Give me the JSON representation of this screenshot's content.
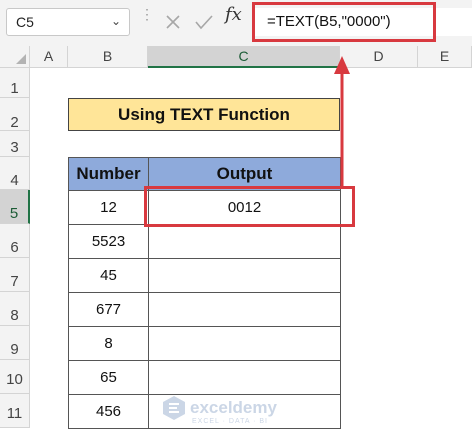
{
  "name_box": {
    "value": "C5"
  },
  "formula_bar": {
    "fx_label": "fx",
    "formula": "=TEXT(B5,\"0000\")"
  },
  "columns": [
    "A",
    "B",
    "C",
    "D",
    "E"
  ],
  "rows": [
    "1",
    "2",
    "3",
    "4",
    "5",
    "6",
    "7",
    "8",
    "9",
    "10",
    "11"
  ],
  "sheet": {
    "title": "Using TEXT Function",
    "headers": {
      "number": "Number",
      "output": "Output"
    },
    "data_rows": [
      {
        "number": "12",
        "output": "0012"
      },
      {
        "number": "5523",
        "output": ""
      },
      {
        "number": "45",
        "output": ""
      },
      {
        "number": "677",
        "output": ""
      },
      {
        "number": "8",
        "output": ""
      },
      {
        "number": "65",
        "output": ""
      },
      {
        "number": "456",
        "output": ""
      }
    ]
  },
  "watermark": {
    "name": "exceldemy",
    "tagline": "EXCEL · DATA · BI"
  },
  "colors": {
    "title_fill": "#ffe598",
    "header_fill": "#8eaadb",
    "highlight": "#d8393f",
    "select_green": "#217346"
  }
}
